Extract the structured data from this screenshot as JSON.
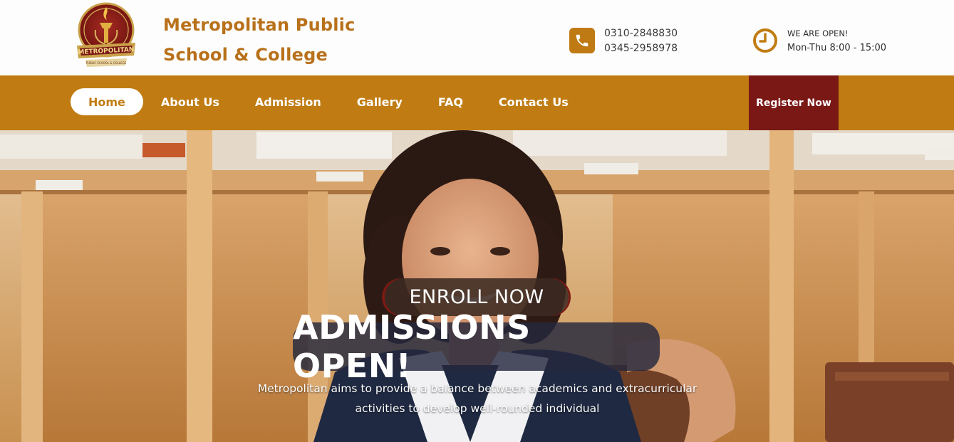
{
  "header": {
    "brand_line1": "Metropolitan Public",
    "brand_line2": "School & College",
    "logo": {
      "icon": "torch-crest-logo",
      "banner_text": "METROPOLITAN",
      "sub_text": "PUBLIC SCHOOL & COLLEGE"
    },
    "contact": {
      "icon": "phone-icon",
      "phone1": "0310-2848830",
      "phone2": "0345-2958978"
    },
    "hours": {
      "icon": "clock-icon",
      "title": "WE ARE OPEN!",
      "time": "Mon-Thu 8:00 - 15:00"
    }
  },
  "nav": {
    "items": [
      {
        "label": "Home",
        "active": true
      },
      {
        "label": "About Us",
        "active": false
      },
      {
        "label": "Admission",
        "active": false
      },
      {
        "label": "Gallery",
        "active": false
      },
      {
        "label": "FAQ",
        "active": false
      },
      {
        "label": "Contact Us",
        "active": false
      }
    ],
    "register_label": "Register Now"
  },
  "hero": {
    "badge": "ENROLL NOW",
    "headline": "ADMISSIONS OPEN!",
    "tagline_line1": "Metropolitan aims to provide a balance between academics and extracurricular",
    "tagline_line2": "activities to develop well-rounded individual"
  },
  "colors": {
    "brand_gold": "#c07c12",
    "brand_text": "#b8711a",
    "register_bg": "#7a1816",
    "enroll_bg": "#3c2a22",
    "headline_bg": "#24283e"
  }
}
